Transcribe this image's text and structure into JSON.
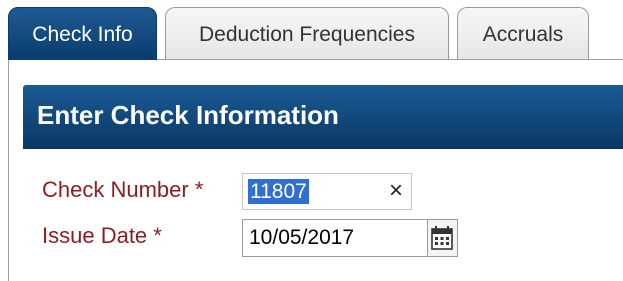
{
  "tabs": [
    {
      "label": "Check Info",
      "active": true
    },
    {
      "label": "Deduction Frequencies",
      "active": false
    },
    {
      "label": "Accruals",
      "active": false
    }
  ],
  "section": {
    "title": "Enter Check Information"
  },
  "form": {
    "check_number": {
      "label": "Check Number *",
      "value": "11807",
      "clear_icon": "×"
    },
    "issue_date": {
      "label": "Issue Date *",
      "value": "10/05/2017",
      "icon": "calendar-icon"
    }
  },
  "colors": {
    "accent_blue": "#0b3d6e",
    "label_red": "#8b1f24",
    "selection_blue": "#2f6fd1"
  }
}
